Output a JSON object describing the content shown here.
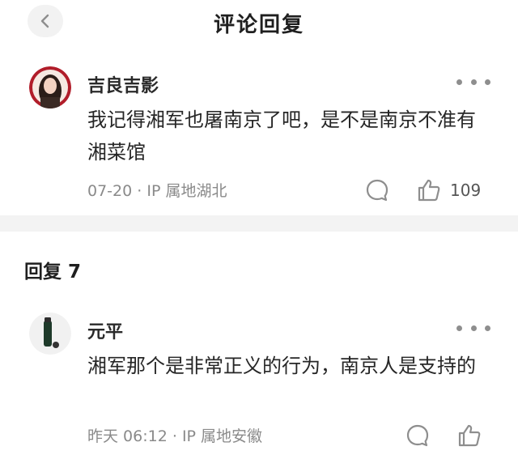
{
  "header": {
    "title": "评论回复"
  },
  "main_comment": {
    "username": "吉良吉影",
    "text": "我记得湘军也屠南京了吧，是不是南京不准有湘菜馆",
    "date": "07-20",
    "ip_location": "IP 属地湖北",
    "like_count": "109"
  },
  "replies_section": {
    "heading": "回复 7",
    "replies": [
      {
        "username": "元平",
        "text": "湘军那个是非常正义的行为，南京人是支持的",
        "date": "昨天 06:12",
        "ip_location": "IP 属地安徽"
      }
    ]
  },
  "colors": {
    "text": "#262626",
    "meta": "#8a8a8a",
    "divider": "#f3f3f3",
    "icon": "#8e8e8e"
  },
  "icons": [
    "back-chevron-icon",
    "more-dots-icon",
    "comment-bubble-icon",
    "thumbs-up-icon"
  ]
}
